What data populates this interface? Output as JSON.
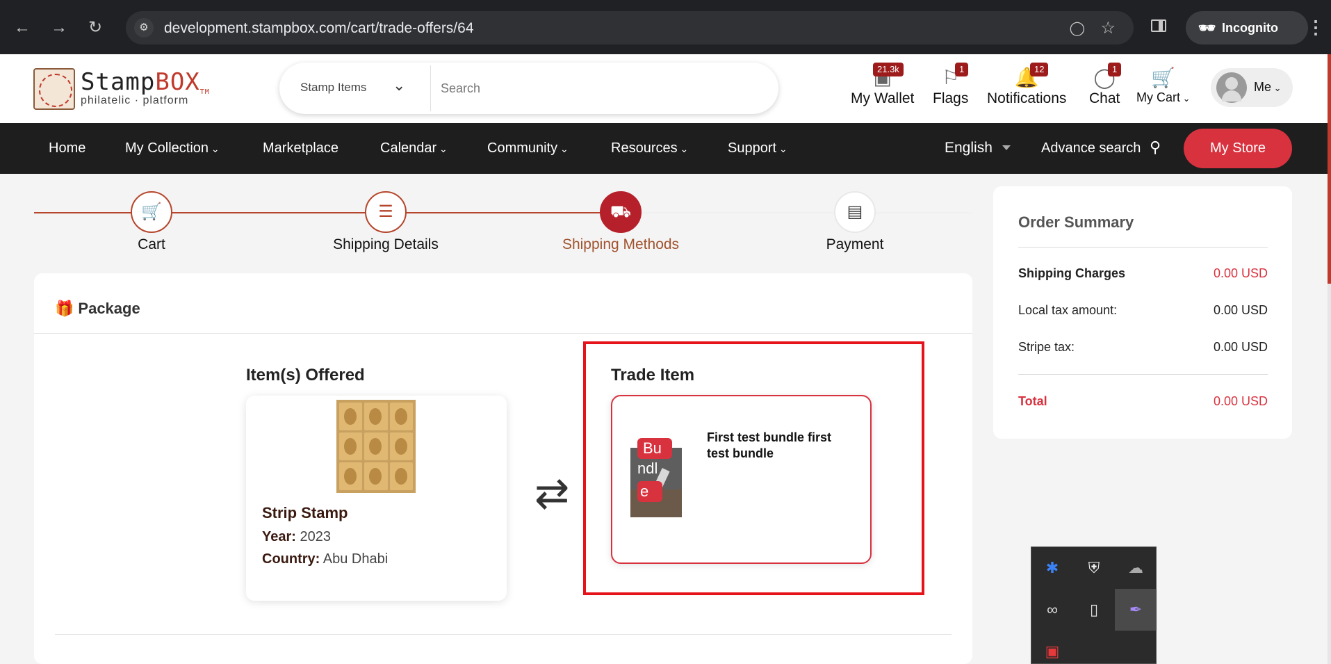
{
  "browser": {
    "url": "development.stampbox.com/cart/trade-offers/64",
    "incognito_label": "Incognito"
  },
  "header": {
    "logo_main": "Stamp",
    "logo_accent": "BOX",
    "logo_tm": "TM",
    "logo_sub": "philatelic · platform",
    "search_category": "Stamp Items",
    "search_placeholder": "Search",
    "wallet": {
      "label": "My Wallet",
      "badge": "21.3k"
    },
    "flags": {
      "label": "Flags",
      "badge": "1"
    },
    "notifications": {
      "label": "Notifications",
      "badge": "12"
    },
    "chat": {
      "label": "Chat",
      "badge": "1"
    },
    "cart": {
      "label": "My Cart"
    },
    "me_label": "Me"
  },
  "navbar": {
    "items": [
      {
        "label": "Home"
      },
      {
        "label": "My Collection"
      },
      {
        "label": "Marketplace"
      },
      {
        "label": "Calendar"
      },
      {
        "label": "Community"
      },
      {
        "label": "Resources"
      },
      {
        "label": "Support"
      }
    ],
    "language": "English",
    "advance_search": "Advance search",
    "my_store": "My Store"
  },
  "stepper": {
    "steps": [
      {
        "label": "Cart",
        "state": "done"
      },
      {
        "label": "Shipping Details",
        "state": "done"
      },
      {
        "label": "Shipping Methods",
        "state": "active"
      },
      {
        "label": "Payment",
        "state": "pending"
      }
    ]
  },
  "package": {
    "title": "Package",
    "offered_title": "Item(s) Offered",
    "trade_title": "Trade Item",
    "offered": {
      "name": "Strip Stamp",
      "year_label": "Year:",
      "year": "2023",
      "country_label": "Country:",
      "country": "Abu Dhabi"
    },
    "trade": {
      "badge_lines": [
        "Bu",
        "ndl",
        "e"
      ],
      "title": "First test bundle first test bundle"
    }
  },
  "summary": {
    "title": "Order Summary",
    "rows": [
      {
        "label": "Shipping Charges",
        "value": "0.00 USD"
      },
      {
        "label": "Local tax amount:",
        "value": "0.00 USD"
      },
      {
        "label": "Stripe tax:",
        "value": "0.00 USD"
      }
    ],
    "total_label": "Total",
    "total_value": "0.00 USD"
  },
  "colors": {
    "brand_red": "#d8323f",
    "step_accent": "#b5452b",
    "highlight": "#e5121a"
  }
}
